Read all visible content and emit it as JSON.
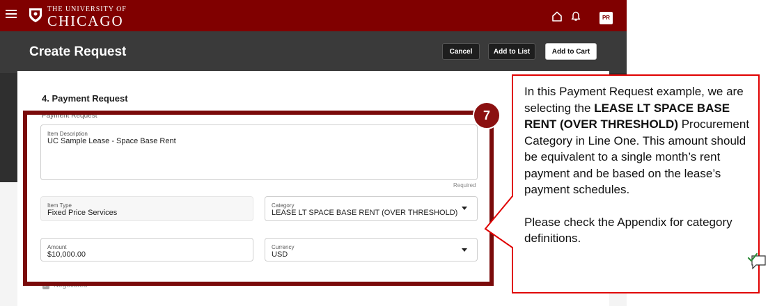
{
  "header": {
    "brand_top": "THE UNIVERSITY OF",
    "brand_main": "CHICAGO",
    "avatar_initials": "PR"
  },
  "page": {
    "title": "Create Request",
    "buttons": {
      "cancel": "Cancel",
      "add_to_list": "Add to List",
      "add_to_cart": "Add to Cart"
    }
  },
  "form": {
    "section_title": "4. Payment Request",
    "section_sublabel": "Payment Request",
    "item_description": {
      "label": "Item Description",
      "value": "UC Sample Lease - Space Base Rent",
      "hint": "Required"
    },
    "item_type": {
      "label": "Item Type",
      "value": "Fixed Price Services"
    },
    "category": {
      "label": "Category",
      "value": "LEASE LT SPACE BASE RENT (OVER THRESHOLD)"
    },
    "amount": {
      "label": "Amount",
      "value": "$10,000.00"
    },
    "currency": {
      "label": "Currency",
      "value": "USD"
    },
    "negotiated": {
      "label": "Negotiated",
      "checked": true
    }
  },
  "annotation": {
    "step_number": "7",
    "text_1": "In this Payment Request example, we are selecting the ",
    "text_bold": "LEASE LT SPACE BASE RENT (OVER THRESHOLD)",
    "text_2": " Procurement Category in Line One. This amount should be equivalent to a single month’s rent payment and be based on the lease’s payment schedules.",
    "text_3": "Please check the Appendix for category definitions."
  },
  "colors": {
    "brand_maroon": "#800000",
    "highlight_frame": "#7a0a0a",
    "callout_border": "#e00000",
    "dark_header": "#2f2f2f"
  },
  "icons": [
    "hamburger-icon",
    "crest-icon",
    "home-icon",
    "bell-icon",
    "checkmark-icon",
    "comment-icon"
  ]
}
